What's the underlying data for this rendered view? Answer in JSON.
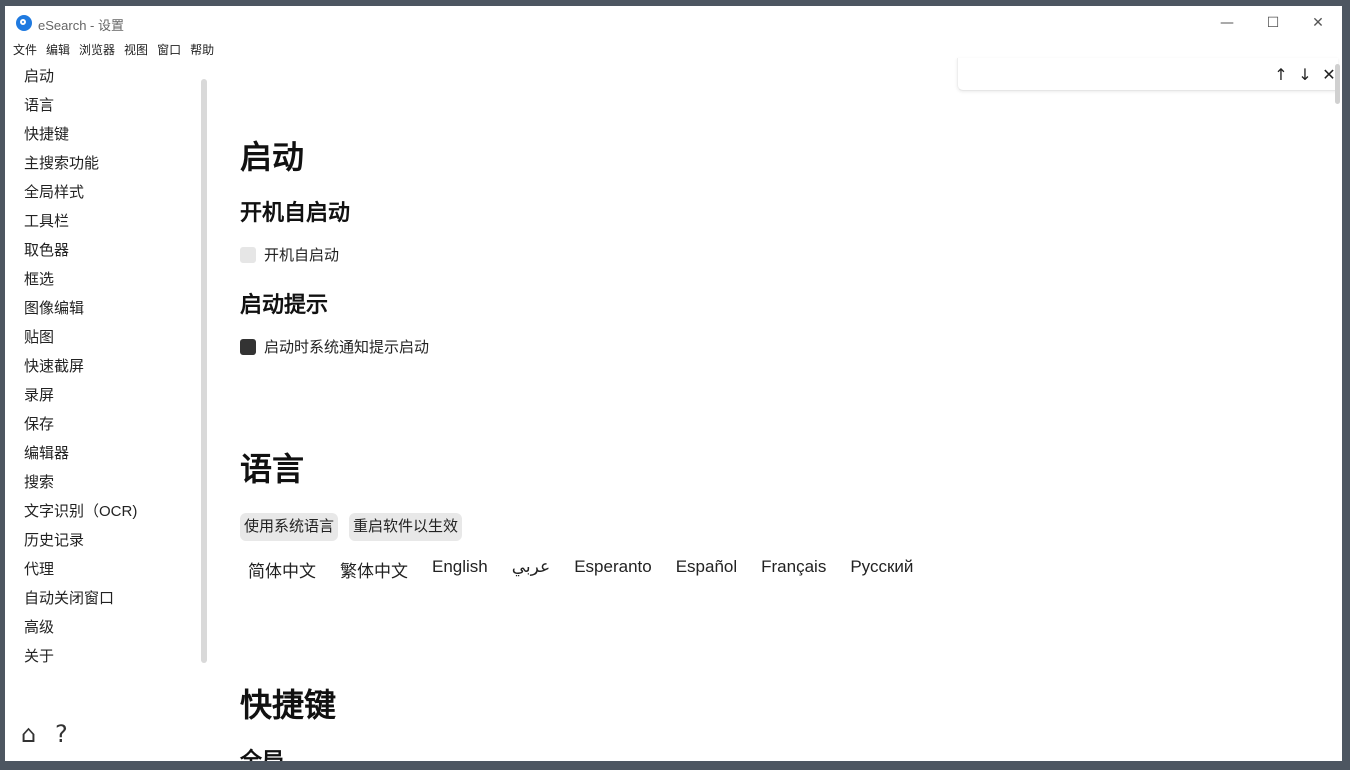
{
  "window": {
    "title": "eSearch - 设置"
  },
  "window_controls": {
    "minimize": "—",
    "maximize": "☐",
    "close": "✕"
  },
  "menu": [
    "文件",
    "编辑",
    "浏览器",
    "视图",
    "窗口",
    "帮助"
  ],
  "sidebar": {
    "items": [
      "启动",
      "语言",
      "快捷键",
      "主搜索功能",
      "全局样式",
      "工具栏",
      "取色器",
      "框选",
      "图像编辑",
      "贴图",
      "快速截屏",
      "录屏",
      "保存",
      "编辑器",
      "搜索",
      "文字识别（OCR)",
      "历史记录",
      "代理",
      "自动关闭窗口",
      "高级",
      "关于"
    ],
    "home_icon": "⌂",
    "help_icon": "?"
  },
  "findbar": {
    "up": "↑",
    "down": "↓",
    "close": "✕"
  },
  "main": {
    "startup": {
      "title": "启动",
      "autostart_heading": "开机自启动",
      "autostart_label": "开机自启动",
      "autostart_checked": false,
      "tip_heading": "启动提示",
      "tip_label": "启动时系统通知提示启动",
      "tip_checked": true
    },
    "language": {
      "title": "语言",
      "use_system": "使用系统语言",
      "restart": "重启软件以生效",
      "options": [
        "简体中文",
        "繁体中文",
        "English",
        "عربي",
        "Esperanto",
        "Español",
        "Français",
        "Русский"
      ]
    },
    "shortcuts": {
      "title": "快捷键",
      "global_heading": "全局"
    }
  }
}
